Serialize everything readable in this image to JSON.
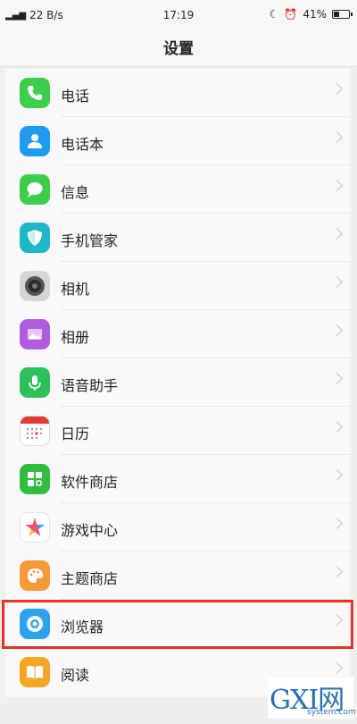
{
  "status": {
    "network": "22 B/s",
    "time": "17:19",
    "battery": "41%",
    "battery_level": 0.41
  },
  "header": {
    "title": "设置"
  },
  "items": [
    {
      "label": "电话",
      "icon": "phone-icon",
      "color": "#3ccf4a"
    },
    {
      "label": "电话本",
      "icon": "contacts-icon",
      "color": "#1e9bf0"
    },
    {
      "label": "信息",
      "icon": "message-icon",
      "color": "#3ccf4a"
    },
    {
      "label": "手机管家",
      "icon": "phone-manager-icon",
      "color": "#1fb8c8"
    },
    {
      "label": "相机",
      "icon": "camera-icon",
      "color": "#cfcfcf"
    },
    {
      "label": "相册",
      "icon": "gallery-icon",
      "color": "#b15be0"
    },
    {
      "label": "语音助手",
      "icon": "voice-assistant-icon",
      "color": "#2cc25a"
    },
    {
      "label": "日历",
      "icon": "calendar-icon",
      "color": "#ffffff"
    },
    {
      "label": "软件商店",
      "icon": "app-store-icon",
      "color": "#2fbd3f"
    },
    {
      "label": "游戏中心",
      "icon": "game-center-icon",
      "color": "#ffffff"
    },
    {
      "label": "主题商店",
      "icon": "theme-store-icon",
      "color": "#f59a36"
    },
    {
      "label": "浏览器",
      "icon": "browser-icon",
      "color": "#2aa4ee"
    },
    {
      "label": "阅读",
      "icon": "reading-icon",
      "color": "#f5a623"
    }
  ],
  "watermark": {
    "logo": "GXI网",
    "site": "system.com"
  }
}
